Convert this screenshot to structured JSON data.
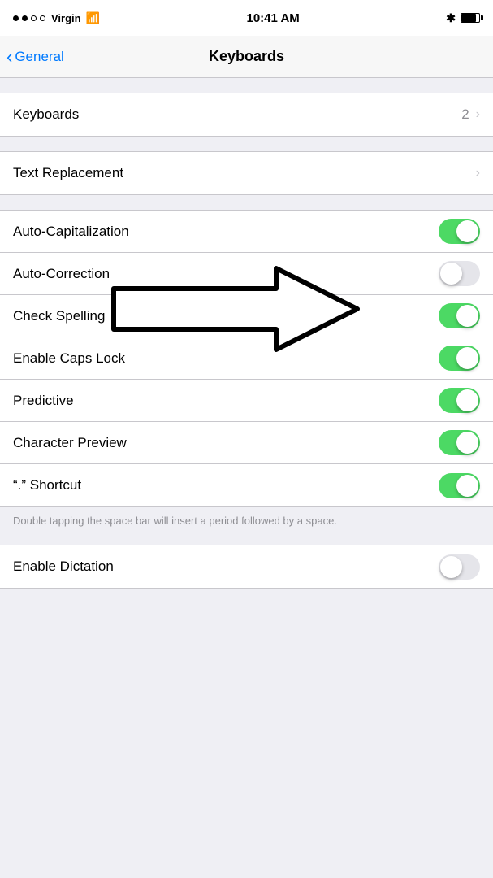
{
  "statusBar": {
    "carrier": "Virgin",
    "time": "10:41 AM",
    "bluetooth": "✦",
    "battery_level": 80
  },
  "navBar": {
    "back_label": "General",
    "title": "Keyboards"
  },
  "groups": [
    {
      "id": "keyboards-group",
      "rows": [
        {
          "id": "keyboards-row",
          "label": "Keyboards",
          "type": "navigate",
          "value": "2"
        }
      ]
    },
    {
      "id": "text-replacement-group",
      "rows": [
        {
          "id": "text-replacement-row",
          "label": "Text Replacement",
          "type": "navigate",
          "value": ""
        }
      ]
    },
    {
      "id": "toggles-group",
      "rows": [
        {
          "id": "auto-cap-row",
          "label": "Auto-Capitalization",
          "type": "toggle",
          "state": "on"
        },
        {
          "id": "auto-correction-row",
          "label": "Auto-Correction",
          "type": "toggle",
          "state": "off"
        },
        {
          "id": "check-spelling-row",
          "label": "Check Spelling",
          "type": "toggle",
          "state": "on"
        },
        {
          "id": "enable-caps-lock-row",
          "label": "Enable Caps Lock",
          "type": "toggle",
          "state": "on"
        },
        {
          "id": "predictive-row",
          "label": "Predictive",
          "type": "toggle",
          "state": "on"
        },
        {
          "id": "character-preview-row",
          "label": "Character Preview",
          "type": "toggle",
          "state": "on"
        },
        {
          "id": "period-shortcut-row",
          "label": "“.” Shortcut",
          "type": "toggle",
          "state": "on"
        }
      ]
    }
  ],
  "periodNote": "Double tapping the space bar will insert a period followed by a space.",
  "enableDictation": {
    "label": "Enable Dictation",
    "state": "off"
  }
}
